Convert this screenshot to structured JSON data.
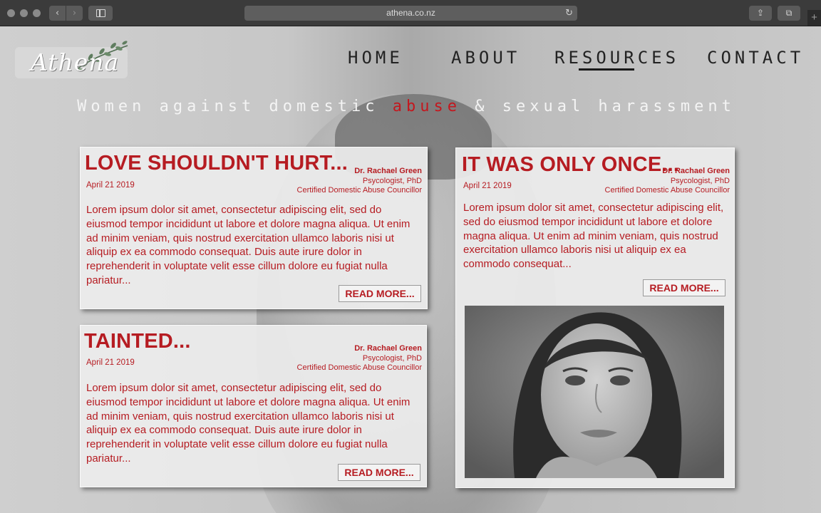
{
  "browser": {
    "url": "athena.co.nz",
    "back": "‹",
    "forward": "›",
    "reload": "↻",
    "share": "⇪",
    "tabs": "⧉",
    "new_tab": "+"
  },
  "site": {
    "logo_text": "Athena",
    "nav": [
      "HOME",
      "ABOUT",
      "RESOURCES",
      "CONTACT"
    ],
    "active_nav": "RESOURCES",
    "tagline_pre": "Women against domestic ",
    "tagline_highlight": "abuse",
    "tagline_post": " & sexual harassment"
  },
  "articles": [
    {
      "title": "LOVE SHOULDN'T HURT...",
      "date": "April 21 2019",
      "author_name": "Dr. Rachael Green",
      "author_role": "Psycologist, PhD",
      "author_cert": "Certified Domestic Abuse Councillor",
      "excerpt": "Lorem ipsum dolor sit amet, consectetur adipiscing elit, sed do eiusmod tempor incididunt ut labore et dolore magna aliqua. Ut enim ad minim veniam, quis nostrud exercitation ullamco laboris nisi ut aliquip ex ea commodo consequat. Duis aute irure dolor in reprehenderit in voluptate velit esse cillum dolore eu fugiat nulla pariatur...",
      "button": "READ MORE..."
    },
    {
      "title": "IT WAS ONLY ONCE...",
      "date": "April 21 2019",
      "author_name": "Dr. Rachael Green",
      "author_role": "Psycologist, PhD",
      "author_cert": "Certified Domestic Abuse Councillor",
      "excerpt": "Lorem ipsum dolor sit amet, consectetur adipiscing elit, sed do eiusmod tempor incididunt ut labore et dolore magna aliqua. Ut enim ad minim veniam, quis nostrud exercitation ullamco laboris nisi ut aliquip ex ea commodo consequat...",
      "button": "READ MORE..."
    },
    {
      "title": "TAINTED...",
      "date": "April 21 2019",
      "author_name": "Dr. Rachael Green",
      "author_role": "Psycologist, PhD",
      "author_cert": "Certified Domestic Abuse Councillor",
      "excerpt": "Lorem ipsum dolor sit amet, consectetur adipiscing elit, sed do eiusmod tempor incididunt ut labore et dolore magna aliqua. Ut enim ad minim veniam, quis nostrud exercitation ullamco laboris nisi ut aliquip ex ea commodo consequat. Duis aute irure dolor in reprehenderit in voluptate velit esse cillum dolore eu fugiat nulla pariatur...",
      "button": "READ MORE..."
    }
  ],
  "colors": {
    "accent": "#b61c22",
    "chrome": "#3b3b3b"
  },
  "icons": [
    "sidebar-icon",
    "reload-icon",
    "share-icon",
    "tabs-icon",
    "leaf-icon"
  ]
}
